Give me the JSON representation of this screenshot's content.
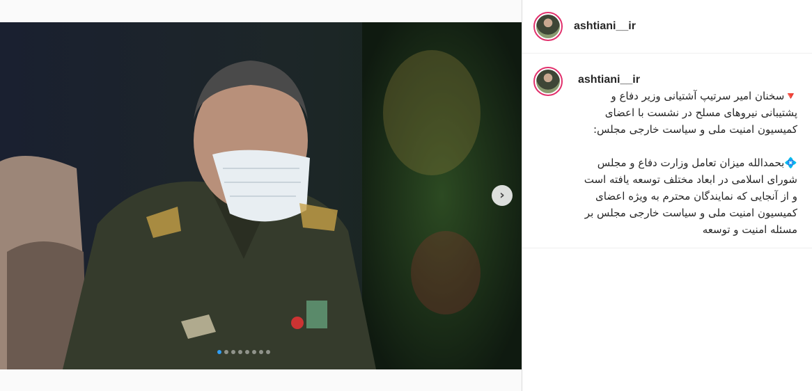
{
  "post": {
    "username": "ashtiani__ir",
    "caption": "🔻سخنان امیر سرتیپ آشتیانی وزیر دفاع و پشتیبانی نیروهای مسلح در نشست با اعضای کمیسیون امنیت ملی و سیاست خارجی مجلس:\n\n💠بحمدالله میزان تعامل وزارت دفاع و مجلس شورای اسلامی در ابعاد مختلف توسعه یافته است و از آنجایی که نمایندگان محترم به ویژه اعضای کمیسیون امنیت ملی و سیاست خارجی مجلس بر مسئله امنیت و توسعه"
  },
  "carousel": {
    "total": 8,
    "active_index": 0,
    "next_icon": "chevron-right-icon"
  },
  "colors": {
    "active_dot": "#2f9ef5",
    "story_ring": "#e1306c"
  }
}
